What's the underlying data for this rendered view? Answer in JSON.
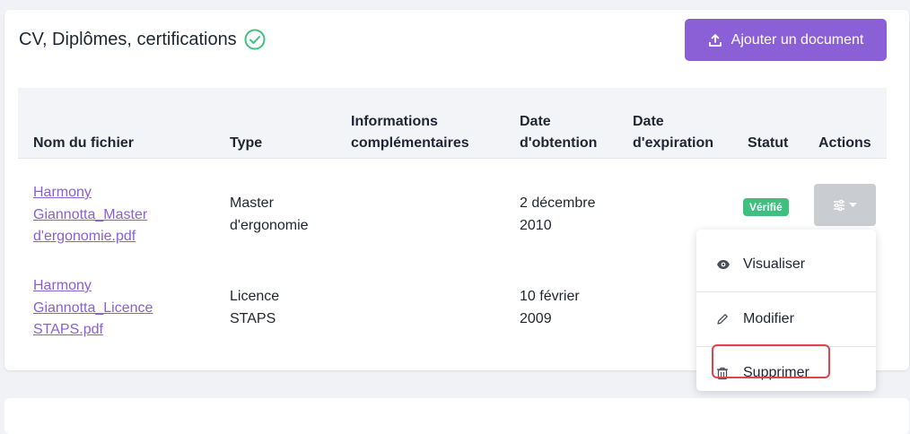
{
  "section": {
    "title": "CV, Diplômes, certifications",
    "add_button_label": "Ajouter un document"
  },
  "table": {
    "headers": {
      "filename": "Nom du fichier",
      "type": "Type",
      "info_line1": "Informations",
      "info_line2": "complémentaires",
      "date_obt_line1": "Date",
      "date_obt_line2": "d'obtention",
      "date_exp_line1": "Date",
      "date_exp_line2": "d'expiration",
      "status": "Statut",
      "actions": "Actions"
    },
    "rows": [
      {
        "file_line1": "Harmony",
        "file_line2": "Giannotta_Master",
        "file_line3": "d'ergonomie.pdf",
        "type_line1": "Master",
        "type_line2": "d'ergonomie",
        "date_line1": "2 décembre",
        "date_line2": "2010",
        "status": "Vérifié"
      },
      {
        "file_line1": "Harmony",
        "file_line2": "Giannotta_Licence",
        "file_line3": "STAPS.pdf",
        "type_line1": "Licence",
        "type_line2": "STAPS",
        "date_line1": "10 février",
        "date_line2": "2009"
      }
    ]
  },
  "menu": {
    "view": "Visualiser",
    "edit": "Modifier",
    "delete": "Supprimer"
  },
  "colors": {
    "accent": "#8b5fd6",
    "verified": "#3fc07e",
    "highlight": "#e0434e"
  }
}
